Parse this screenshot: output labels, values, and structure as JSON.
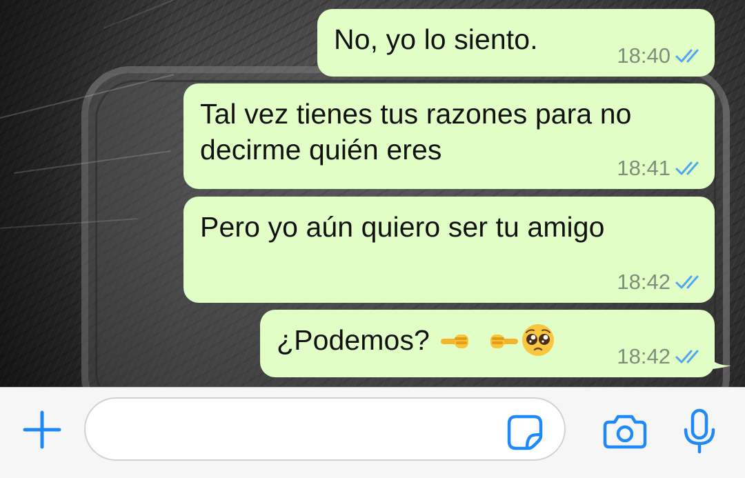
{
  "colors": {
    "outgoing_bubble": "#e1fec6",
    "accent_blue": "#1f8af5",
    "read_checks": "#4fa7ef",
    "timestamp": "#7d8f7a"
  },
  "messages": [
    {
      "text": "No, yo lo siento.",
      "time": "18:40",
      "status": "read-double-check-icon"
    },
    {
      "text": "Tal vez tienes tus razones para no\ndecirme quién eres",
      "time": "18:41",
      "status": "read-double-check-icon"
    },
    {
      "text": "Pero yo aún quiero ser tu amigo",
      "time": "18:42",
      "status": "read-double-check-icon"
    },
    {
      "text": "¿Podemos?",
      "emoji": [
        "backhand-index-pointing-right-icon",
        "backhand-index-pointing-left-icon",
        "pleading-face-icon"
      ],
      "time": "18:42",
      "status": "read-double-check-icon"
    }
  ],
  "composer": {
    "value": "",
    "placeholder": "",
    "icons": [
      "plus-icon",
      "sticker-icon",
      "camera-icon",
      "microphone-icon"
    ]
  }
}
